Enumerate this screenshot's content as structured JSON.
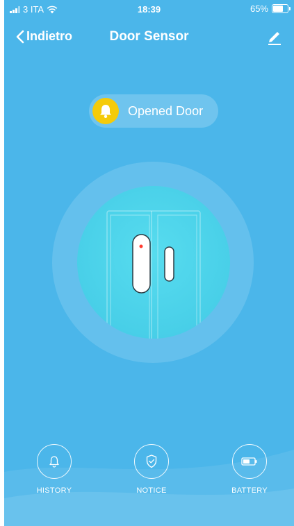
{
  "status_bar": {
    "carrier": "3 ITA",
    "time": "18:39",
    "battery_percent": "65%",
    "wifi_icon": "wifi-icon",
    "battery_icon": "battery-icon"
  },
  "nav": {
    "back_label": "Indietro",
    "title": "Door Sensor",
    "edit_icon": "pencil-icon"
  },
  "status": {
    "label": "Opened Door",
    "icon": "bell-icon",
    "icon_color": "#f5cb0a"
  },
  "sensor": {
    "state": "open",
    "indicator_color": "#ff3b30"
  },
  "actions": [
    {
      "label": "HISTORY",
      "icon": "bell-outline-icon"
    },
    {
      "label": "NOTICE",
      "icon": "shield-check-icon"
    },
    {
      "label": "BATTERY",
      "icon": "battery-icon"
    }
  ],
  "colors": {
    "background": "#4bb6ea",
    "sensor_circle": "#4fd4eb",
    "accent_yellow": "#f5cb0a"
  }
}
